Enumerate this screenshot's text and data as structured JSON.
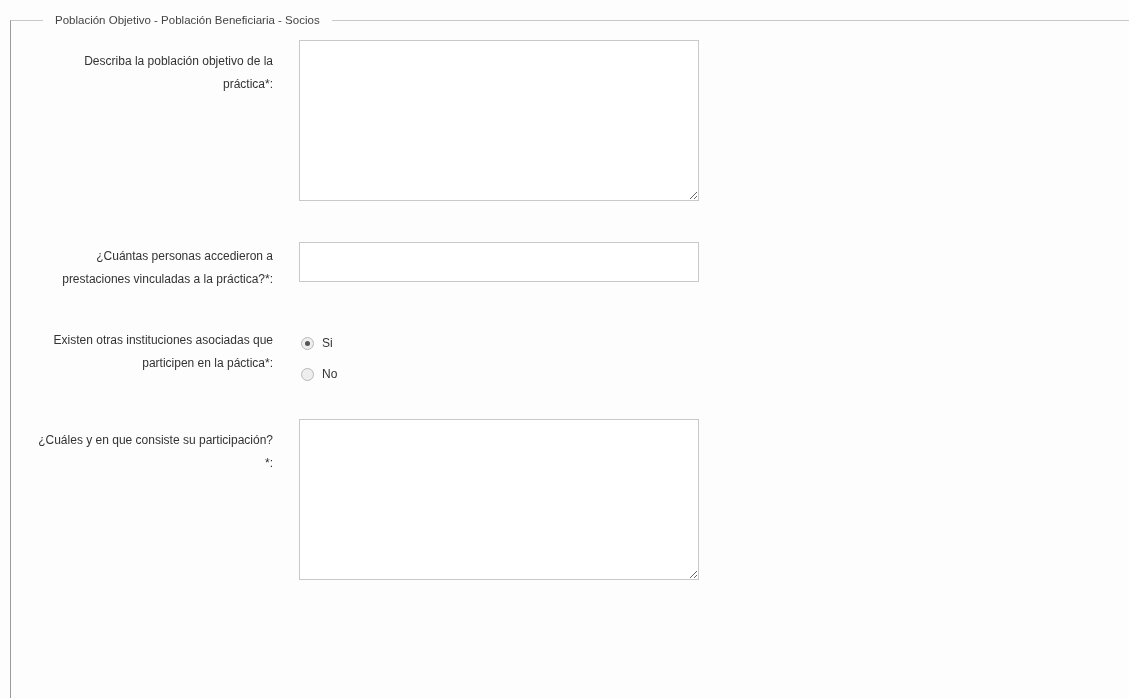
{
  "section": {
    "legend": "Población Objetivo - Población Beneficiaria - Socios",
    "fields": [
      {
        "kind": "textarea",
        "label": "Describa la población objetivo de la práctica*:"
      },
      {
        "kind": "text",
        "label": "¿Cuántas personas accedieron a prestaciones vinculadas a la práctica?*:"
      },
      {
        "kind": "radio",
        "label": "Existen otras instituciones asociadas que participen en la páctica*:",
        "options": [
          {
            "label": "Si",
            "selected": true
          },
          {
            "label": "No",
            "selected": false
          }
        ]
      },
      {
        "kind": "textarea",
        "label": "¿Cuáles y en que consiste su participación?*:"
      }
    ]
  }
}
